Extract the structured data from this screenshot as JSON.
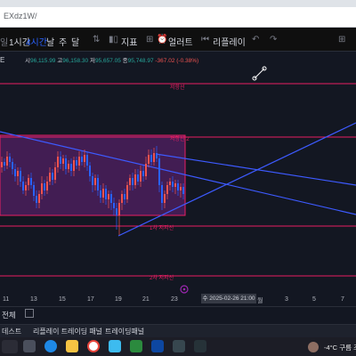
{
  "browser": {
    "url": "EXdz1W/"
  },
  "toolbar": {
    "chart_type_glyph": "일",
    "interval_1": "1시간",
    "interval_4": "4시간",
    "interval_day": "날",
    "interval_week": "주",
    "interval_month": "달",
    "indicators": "지표",
    "alert": "얼러트",
    "replay": "리플레이"
  },
  "legend": {
    "symbol": "E",
    "o_label": "시",
    "o_value": "96,115.99",
    "h_label": "고",
    "h_value": "96,158.30",
    "l_label": "저",
    "l_value": "95,657.05",
    "c_label": "종",
    "c_value": "95,748.97",
    "change": "-367.02 (-0.38%)"
  },
  "chart_labels": {
    "upper_line": "저항선",
    "box_top": "저항선 2",
    "support_1": "1차 지지선",
    "support_2": "2차 지지선",
    "left_marker": "E"
  },
  "x_axis": {
    "ticks": [
      "11",
      "13",
      "15",
      "17",
      "19",
      "21",
      "23",
      "3",
      "5",
      "7"
    ],
    "crosshair_label": "수 2025-02-26  21:00",
    "partial_tick": "월"
  },
  "bottom": {
    "range_label": "전체"
  },
  "panel_tabs": [
    "데스트",
    "리플레이 트레이딩 패널",
    "트레이딩패널"
  ],
  "taskbar": {
    "weather": "-4°C  구름 조"
  },
  "colors": {
    "resistance": "#e91e63",
    "trend": "#3d5afe",
    "box_fill": "rgba(156,39,176,0.35)",
    "up_candle": "#ef5350",
    "down_candle": "#2962ff"
  }
}
